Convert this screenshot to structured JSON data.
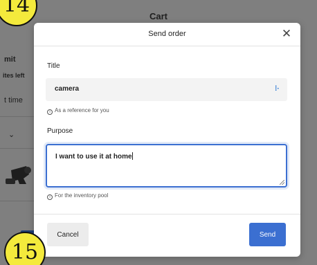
{
  "background": {
    "page_title": "Cart",
    "limit_label": "mit",
    "items_left_label": "ites left",
    "time_label": "t time",
    "chevron": "⌄"
  },
  "badges": {
    "step_a": "14",
    "step_b": "15"
  },
  "modal": {
    "title": "Send order",
    "close_icon": "close-icon",
    "title_field": {
      "label": "Title",
      "value": "camera",
      "hint": "As a reference for you"
    },
    "purpose_field": {
      "label": "Purpose",
      "value": "I want to use it at home",
      "hint": "For the inventory pool"
    },
    "cancel_label": "Cancel",
    "send_label": "Send"
  },
  "colors": {
    "accent": "#3b6fd1",
    "badge": "#f4ea3c",
    "overlay": "#7f7f7f"
  }
}
